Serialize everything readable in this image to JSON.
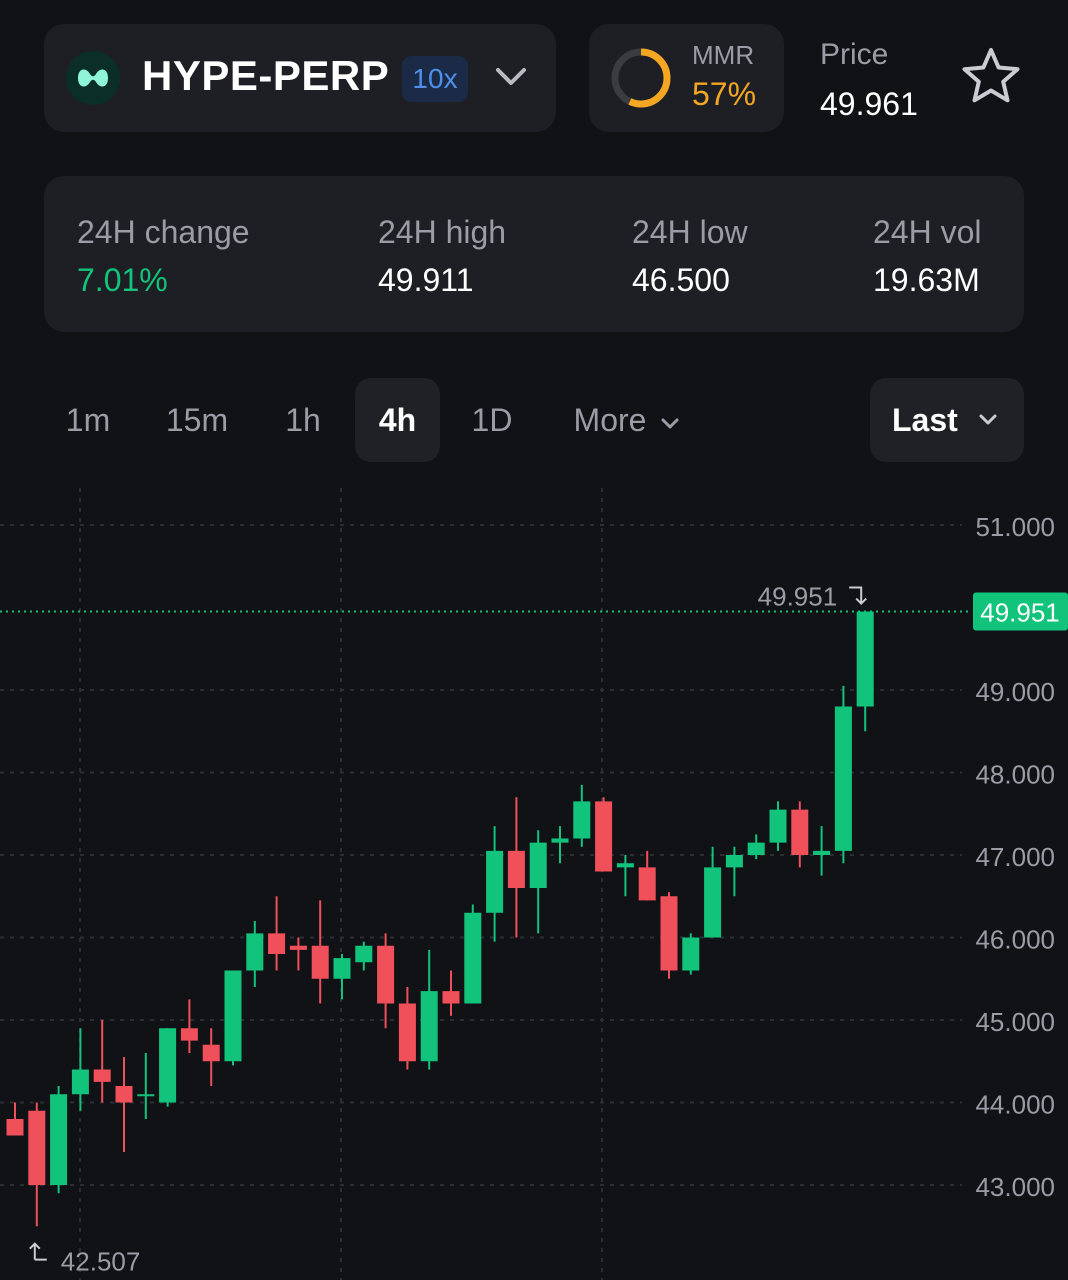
{
  "market": {
    "symbol": "HYPE-PERP",
    "leverage": "10x",
    "logo_icon": "hyperliquid-logo-icon",
    "dropdown_icon": "chevron-down-icon"
  },
  "mmr": {
    "label": "MMR",
    "value": "57%",
    "fraction": 0.57,
    "color": "#f5a623"
  },
  "price": {
    "label": "Price",
    "value": "49.961"
  },
  "favorite_icon": "star-icon",
  "stats": [
    {
      "label": "24H change",
      "value": "7.01%"
    },
    {
      "label": "24H high",
      "value": "49.911"
    },
    {
      "label": "24H low",
      "value": "46.500"
    },
    {
      "label": "24H vol",
      "value": "19.63M"
    }
  ],
  "timeframes": {
    "items": [
      "1m",
      "15m",
      "1h",
      "4h",
      "1D"
    ],
    "active": "4h",
    "more_label": "More"
  },
  "price_source": {
    "label": "Last"
  },
  "colors": {
    "up": "#12c47b",
    "down": "#f0505a",
    "accent": "#f5a623",
    "background": "#111216"
  },
  "chart_data": {
    "type": "candlestick",
    "y_ticks": [
      "51.000",
      "49.000",
      "48.000",
      "47.000",
      "46.000",
      "45.000",
      "44.000",
      "43.000"
    ],
    "ylim": [
      42.3,
      51.2
    ],
    "last_price_label": "49.951",
    "last_price": 49.951,
    "high_marker": {
      "label": "49.951",
      "value": 49.951
    },
    "low_marker": {
      "label": "42.507",
      "value": 42.507
    },
    "candles": [
      {
        "o": 43.8,
        "h": 44.0,
        "l": 43.6,
        "c": 43.6
      },
      {
        "o": 43.9,
        "h": 44.0,
        "l": 42.5,
        "c": 43.0
      },
      {
        "o": 43.0,
        "h": 44.2,
        "l": 42.9,
        "c": 44.1
      },
      {
        "o": 44.1,
        "h": 44.9,
        "l": 43.9,
        "c": 44.4
      },
      {
        "o": 44.4,
        "h": 45.0,
        "l": 44.0,
        "c": 44.25
      },
      {
        "o": 44.2,
        "h": 44.55,
        "l": 43.4,
        "c": 44.0
      },
      {
        "o": 44.1,
        "h": 44.6,
        "l": 43.8,
        "c": 44.1
      },
      {
        "o": 44.0,
        "h": 44.9,
        "l": 43.95,
        "c": 44.9
      },
      {
        "o": 44.9,
        "h": 45.25,
        "l": 44.6,
        "c": 44.75
      },
      {
        "o": 44.7,
        "h": 44.9,
        "l": 44.2,
        "c": 44.5
      },
      {
        "o": 44.5,
        "h": 45.55,
        "l": 44.45,
        "c": 45.6
      },
      {
        "o": 45.6,
        "h": 46.2,
        "l": 45.4,
        "c": 46.05
      },
      {
        "o": 46.05,
        "h": 46.5,
        "l": 45.6,
        "c": 45.8
      },
      {
        "o": 45.9,
        "h": 46.0,
        "l": 45.6,
        "c": 45.85
      },
      {
        "o": 45.9,
        "h": 46.45,
        "l": 45.2,
        "c": 45.5
      },
      {
        "o": 45.5,
        "h": 45.8,
        "l": 45.25,
        "c": 45.75
      },
      {
        "o": 45.7,
        "h": 45.95,
        "l": 45.6,
        "c": 45.9
      },
      {
        "o": 45.9,
        "h": 46.05,
        "l": 44.9,
        "c": 45.2
      },
      {
        "o": 45.2,
        "h": 45.4,
        "l": 44.4,
        "c": 44.5
      },
      {
        "o": 44.5,
        "h": 45.85,
        "l": 44.4,
        "c": 45.35
      },
      {
        "o": 45.35,
        "h": 45.6,
        "l": 45.05,
        "c": 45.2
      },
      {
        "o": 45.2,
        "h": 46.4,
        "l": 45.2,
        "c": 46.3
      },
      {
        "o": 46.3,
        "h": 47.35,
        "l": 45.95,
        "c": 47.05
      },
      {
        "o": 47.05,
        "h": 47.7,
        "l": 46.0,
        "c": 46.6
      },
      {
        "o": 46.6,
        "h": 47.3,
        "l": 46.05,
        "c": 47.15
      },
      {
        "o": 47.15,
        "h": 47.35,
        "l": 46.9,
        "c": 47.2
      },
      {
        "o": 47.2,
        "h": 47.85,
        "l": 47.1,
        "c": 47.65
      },
      {
        "o": 47.65,
        "h": 47.7,
        "l": 46.8,
        "c": 46.8
      },
      {
        "o": 46.85,
        "h": 47.0,
        "l": 46.5,
        "c": 46.9
      },
      {
        "o": 46.85,
        "h": 47.05,
        "l": 46.45,
        "c": 46.45
      },
      {
        "o": 46.5,
        "h": 46.55,
        "l": 45.5,
        "c": 45.6
      },
      {
        "o": 45.6,
        "h": 46.05,
        "l": 45.55,
        "c": 46.0
      },
      {
        "o": 46.0,
        "h": 47.1,
        "l": 46.0,
        "c": 46.85
      },
      {
        "o": 46.85,
        "h": 47.1,
        "l": 46.5,
        "c": 47.0
      },
      {
        "o": 47.0,
        "h": 47.25,
        "l": 46.95,
        "c": 47.15
      },
      {
        "o": 47.15,
        "h": 47.65,
        "l": 47.05,
        "c": 47.55
      },
      {
        "o": 47.55,
        "h": 47.65,
        "l": 46.85,
        "c": 47.0
      },
      {
        "o": 47.0,
        "h": 47.35,
        "l": 46.75,
        "c": 47.05
      },
      {
        "o": 47.05,
        "h": 49.05,
        "l": 46.9,
        "c": 48.8
      },
      {
        "o": 48.8,
        "h": 49.95,
        "l": 48.5,
        "c": 49.951
      }
    ]
  }
}
